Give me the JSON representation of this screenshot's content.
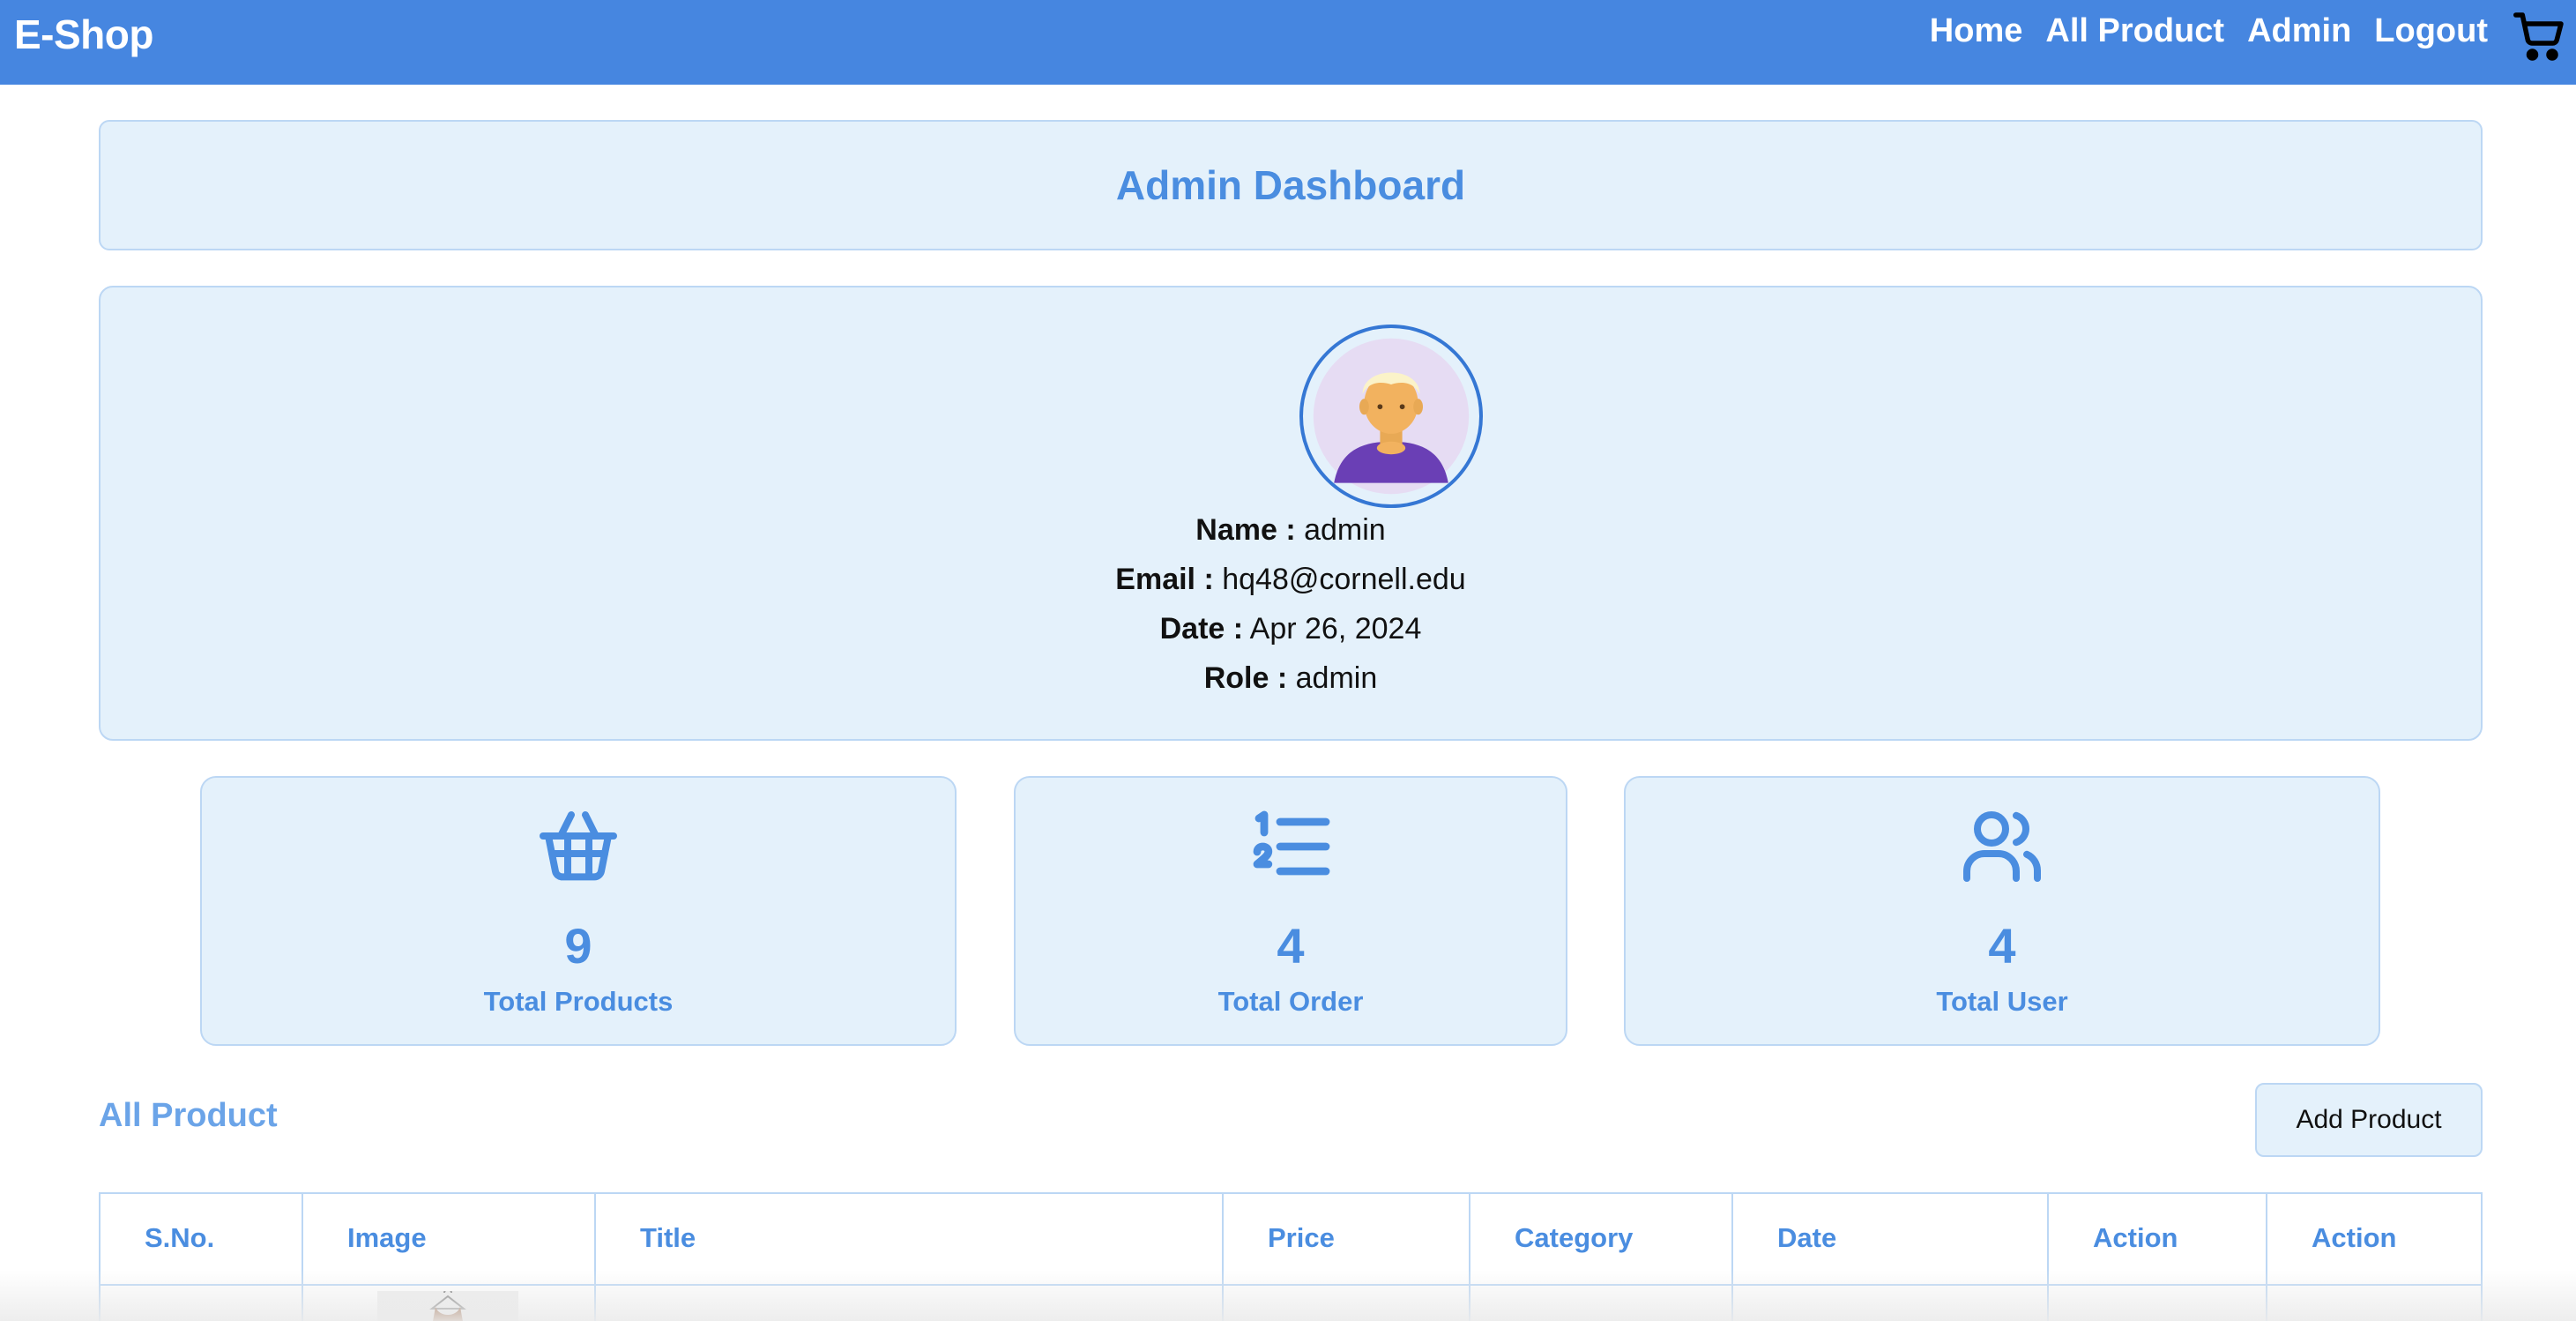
{
  "navbar": {
    "brand": "E-Shop",
    "links": [
      "Home",
      "All Product",
      "Admin",
      "Logout"
    ],
    "cart_icon": "cart-icon"
  },
  "dashboard": {
    "title": "Admin Dashboard"
  },
  "profile": {
    "avatar_icon": "user-avatar",
    "name_label": "Name :",
    "name": "admin",
    "email_label": "Email :",
    "email": "hq48@cornell.edu",
    "date_label": "Date :",
    "date": "Apr 26, 2024",
    "role_label": "Role :",
    "role": "admin"
  },
  "stats": [
    {
      "icon": "basket-icon",
      "value": "9",
      "label": "Total Products"
    },
    {
      "icon": "list-ordered-icon",
      "value": "4",
      "label": "Total Order"
    },
    {
      "icon": "users-icon",
      "value": "4",
      "label": "Total User"
    }
  ],
  "products": {
    "section_title": "All Product",
    "add_button": "Add Product",
    "columns": [
      "S.No.",
      "Image",
      "Title",
      "Price",
      "Category",
      "Date",
      "Action",
      "Action"
    ]
  },
  "colors": {
    "primary": "#4686e0",
    "card_bg": "#e4f1fb",
    "card_border": "#bcd7f4",
    "accent_text": "#4a8de0"
  }
}
